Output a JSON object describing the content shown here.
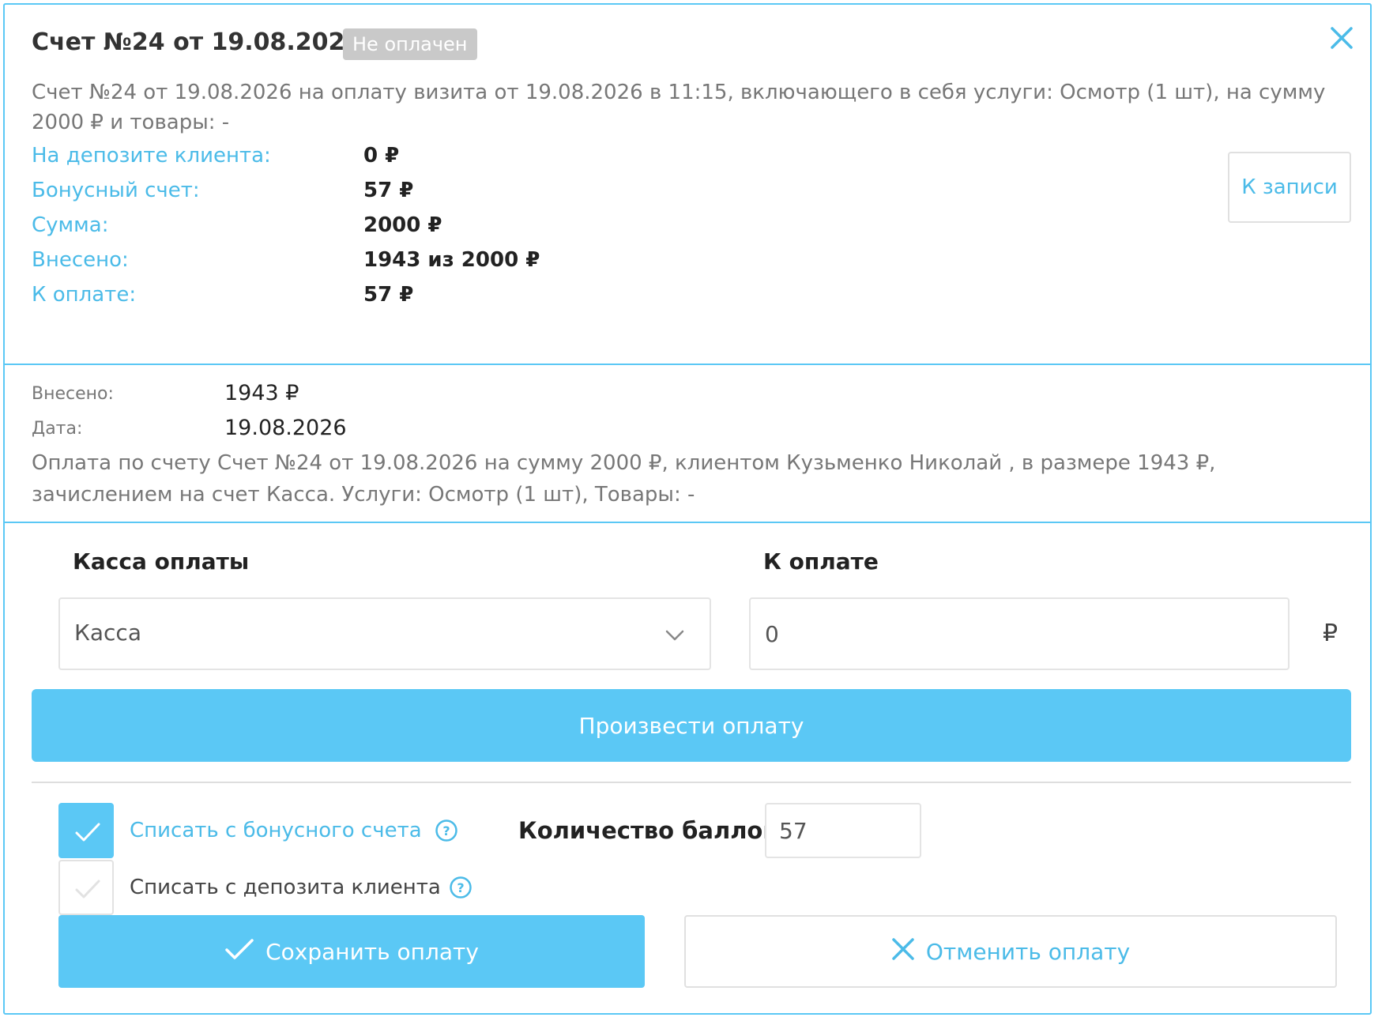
{
  "header": {
    "title": "Счет №24 от 19.08.2026",
    "status": "Не оплачен"
  },
  "description": "Счет №24 от 19.08.2026 на оплату визита от 19.08.2026 в 11:15, включающего в себя услуги: Осмотр (1 шт), на сумму 2000 ₽ и товары: -",
  "info": {
    "rows": [
      {
        "label": "На депозите клиента:",
        "value": "0 ₽"
      },
      {
        "label": "Бонусный счет:",
        "value": "57 ₽"
      },
      {
        "label": "Сумма:",
        "value": "2000 ₽"
      },
      {
        "label": "Внесено:",
        "value": "1943 из 2000 ₽"
      },
      {
        "label": "К оплате:",
        "value": "57 ₽"
      }
    ],
    "to_record_label": "К записи"
  },
  "payment": {
    "paid_label": "Внесено:",
    "paid_value": "1943 ₽",
    "date_label": "Дата:",
    "date_value": "19.08.2026",
    "description": "Оплата по счету Счет №24 от 19.08.2026 на сумму 2000 ₽, клиентом Кузьменко Николай , в размере 1943 ₽, зачислением на счет Касса. Услуги: Осмотр (1 шт), Товары: -"
  },
  "form": {
    "cashbox_title": "Касса оплаты",
    "cashbox_value": "Касса",
    "amount_title": "К оплате",
    "amount_value": "0",
    "currency": "₽",
    "pay_button": "Произвести оплату"
  },
  "options": {
    "bonus": {
      "label": "Списать с бонусного счета",
      "checked": true
    },
    "deposit": {
      "label": "Списать с депозита клиента",
      "checked": false
    },
    "points_label": "Количество баллов",
    "points_value": "57"
  },
  "actions": {
    "save": "Сохранить оплату",
    "cancel": "Отменить оплату"
  },
  "colors": {
    "accent": "#5bc8f5",
    "link": "#4bbbe8",
    "badge": "#c9c9c9"
  },
  "icons": {
    "close": "close-icon",
    "chevron": "chevron-down-icon",
    "help": "help-icon",
    "check": "checkmark-icon",
    "cancel": "x-icon"
  }
}
